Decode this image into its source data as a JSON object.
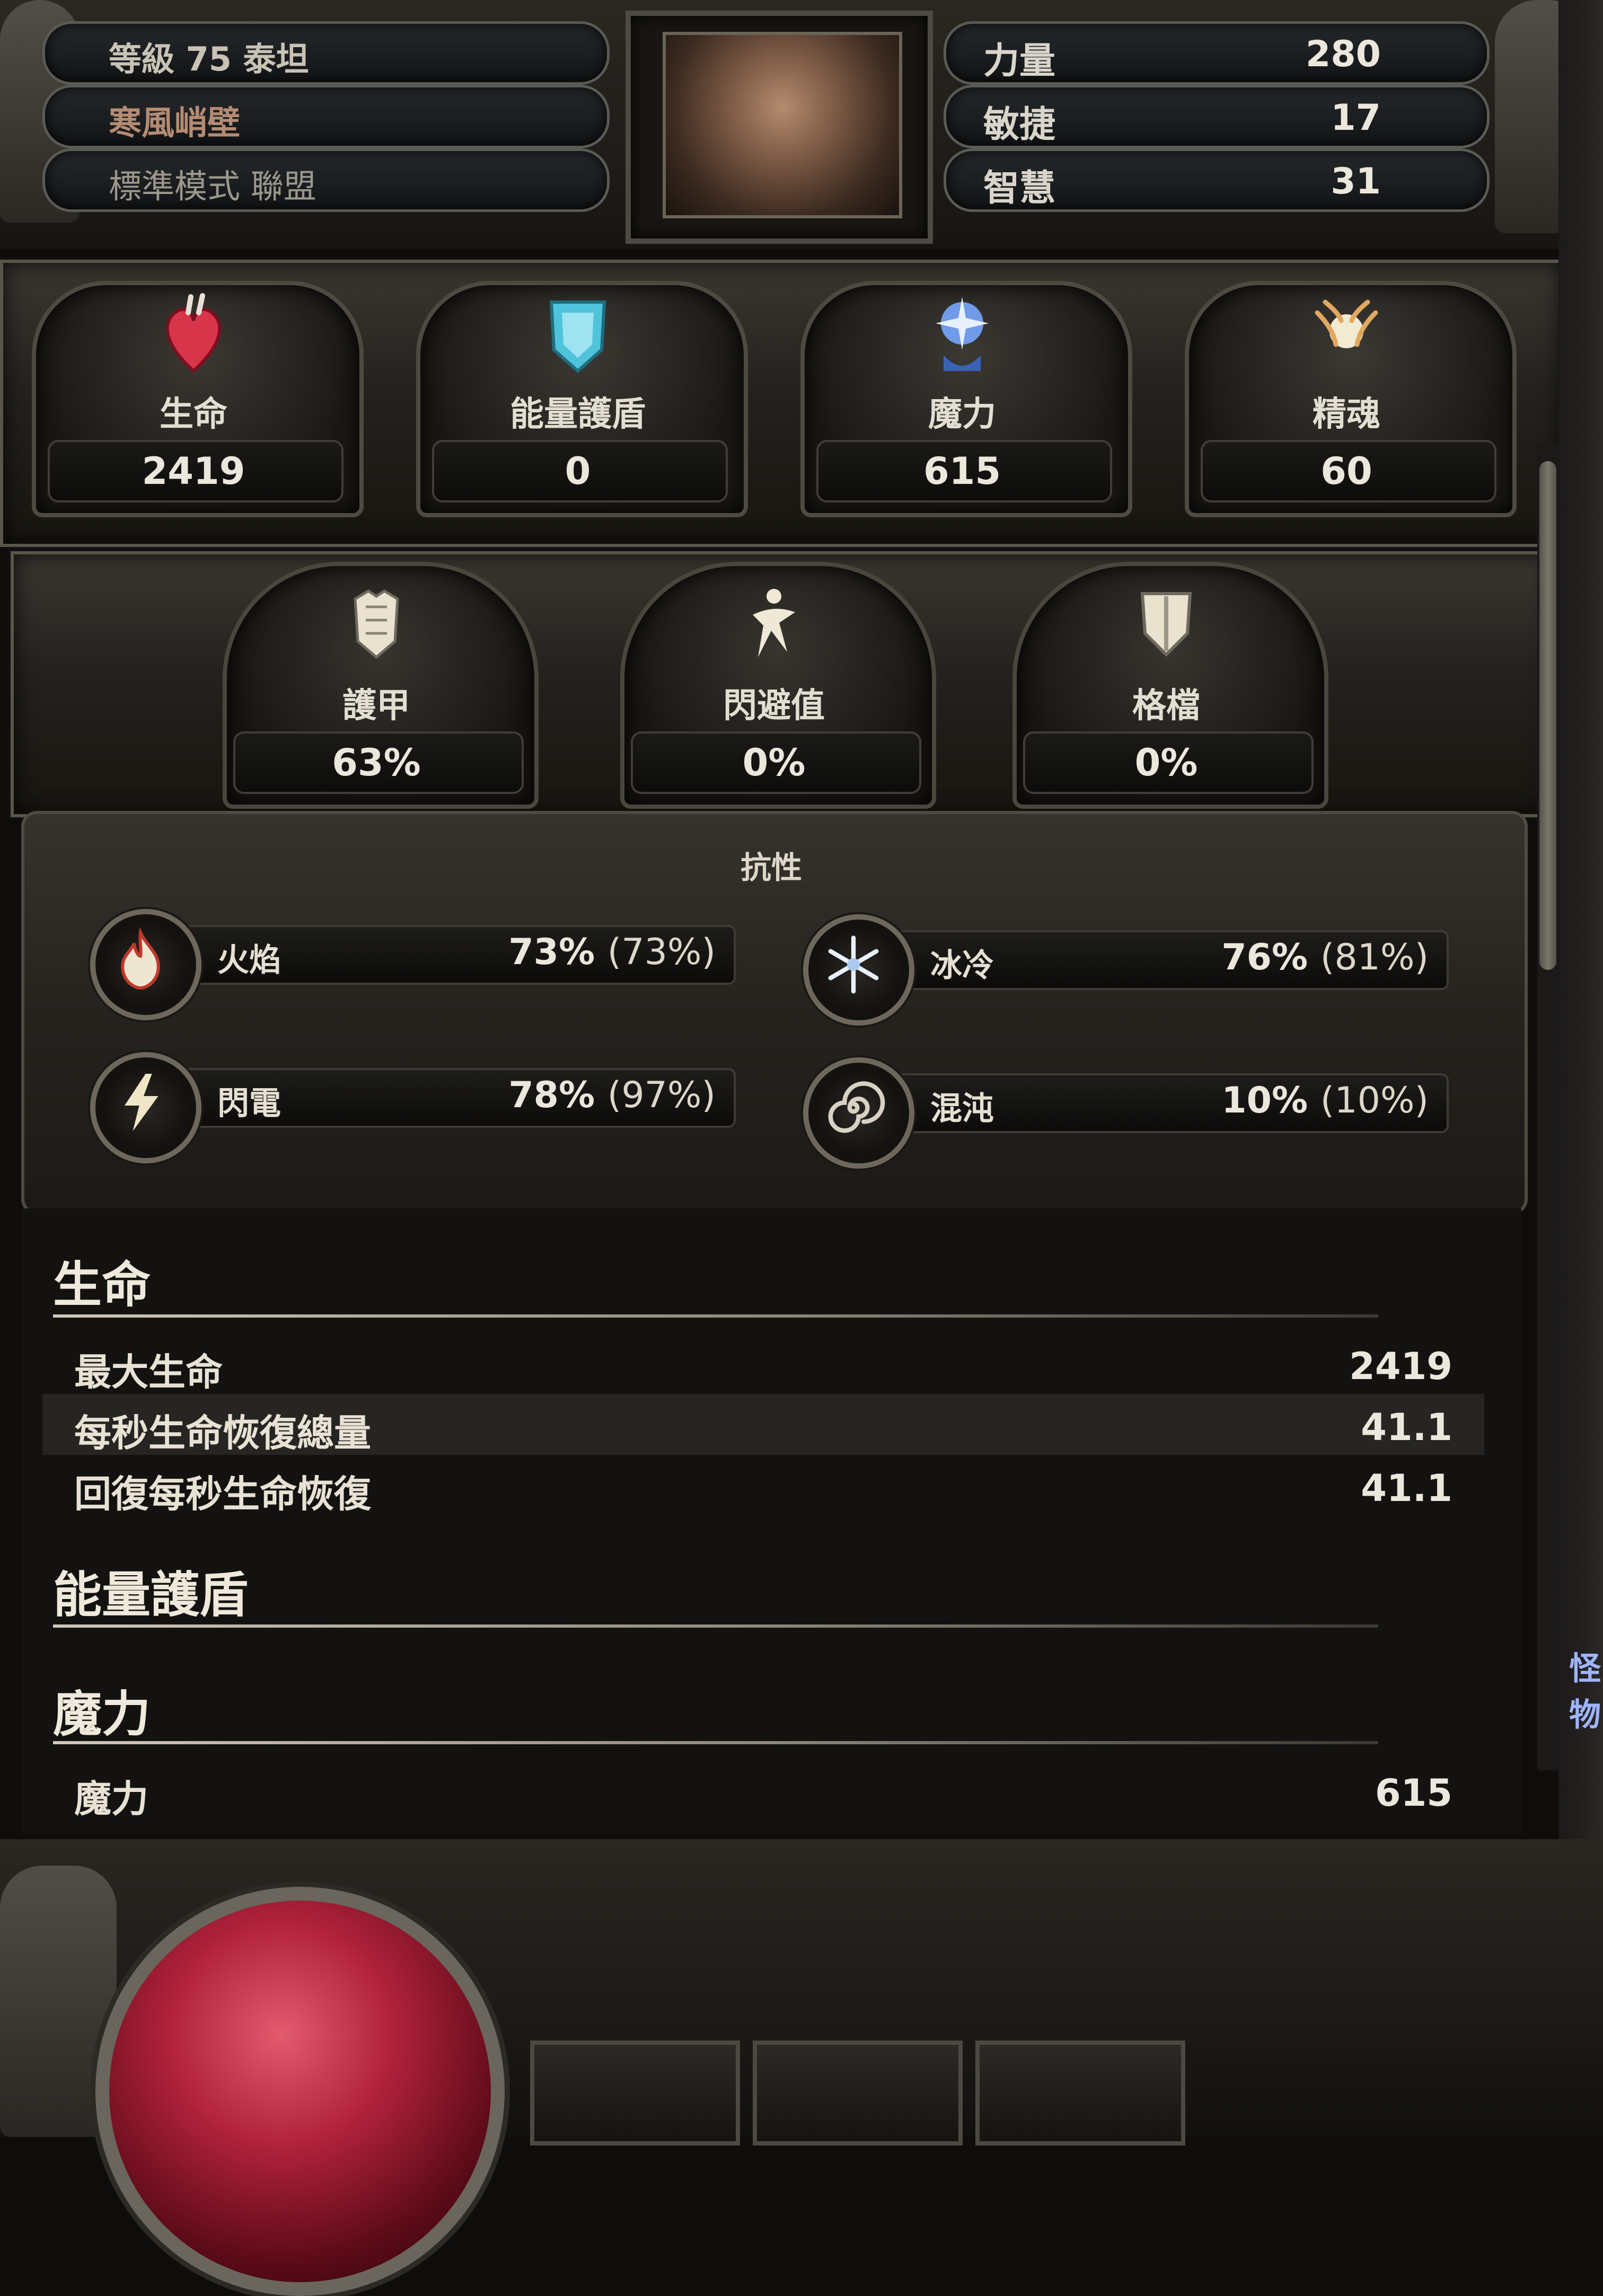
{
  "header": {
    "level_class": "等級 75 泰坦",
    "area": "寒風峭壁",
    "mode": "標準模式 聯盟",
    "attributes": [
      {
        "label": "力量",
        "value": "280"
      },
      {
        "label": "敏捷",
        "value": "17"
      },
      {
        "label": "智慧",
        "value": "31"
      }
    ]
  },
  "primary_stats": [
    {
      "label": "生命",
      "value": "2419",
      "icon": "heart-icon",
      "color": "#d8344a"
    },
    {
      "label": "能量護盾",
      "value": "0",
      "icon": "shield-crest-icon",
      "color": "#4fc3d9"
    },
    {
      "label": "魔力",
      "value": "615",
      "icon": "mana-burst-icon",
      "color": "#5a8ee8"
    },
    {
      "label": "精魂",
      "value": "60",
      "icon": "spirit-orb-icon",
      "color": "#e0c080"
    }
  ],
  "defense_stats": [
    {
      "label": "護甲",
      "value": "63%",
      "icon": "armor-icon"
    },
    {
      "label": "閃避值",
      "value": "0%",
      "icon": "evasion-icon"
    },
    {
      "label": "格檔",
      "value": "0%",
      "icon": "block-shield-icon"
    }
  ],
  "resistances": {
    "title": "抗性",
    "items": [
      {
        "name": "火焰",
        "value": "73%",
        "cap": "(73%)",
        "icon": "fire-icon",
        "color": "#d44a3a"
      },
      {
        "name": "冰冷",
        "value": "76%",
        "cap": "(81%)",
        "icon": "snowflake-icon",
        "color": "#a9c9ee"
      },
      {
        "name": "閃電",
        "value": "78%",
        "cap": "(97%)",
        "icon": "lightning-icon",
        "color": "#f0e7c8"
      },
      {
        "name": "混沌",
        "value": "10%",
        "cap": "(10%)",
        "icon": "chaos-spiral-icon",
        "color": "#d8d2c4"
      }
    ]
  },
  "details": {
    "life": {
      "title": "生命",
      "rows": [
        {
          "label": "最大生命",
          "value": "2419"
        },
        {
          "label": "每秒生命恢復總量",
          "value": "41.1"
        },
        {
          "label": "回復每秒生命恢復",
          "value": "41.1"
        }
      ]
    },
    "energy_shield": {
      "title": "能量護盾"
    },
    "mana": {
      "title": "魔力",
      "rows": [
        {
          "label": "魔力",
          "value": "615"
        }
      ]
    }
  },
  "side_text": "怪物"
}
